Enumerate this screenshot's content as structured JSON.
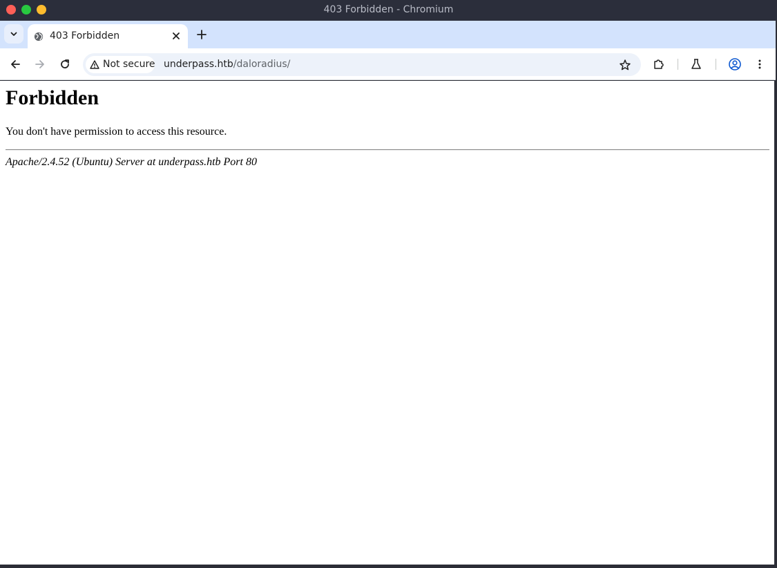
{
  "window": {
    "title": "403 Forbidden - Chromium"
  },
  "tabs": [
    {
      "title": "403 Forbidden",
      "icon": "globe-icon",
      "active": true
    }
  ],
  "toolbar": {
    "security_label": "Not secure",
    "url_host": "underpass.htb",
    "url_path": "/daloradius/"
  },
  "page": {
    "heading": "Forbidden",
    "message": "You don't have permission to access this resource.",
    "server_signature": "Apache/2.4.52 (Ubuntu) Server at underpass.htb Port 80"
  },
  "colors": {
    "titlebar": "#2b2e3b",
    "tabstrip": "#d3e3fd",
    "omnibox": "#edf2fa",
    "close": "#ff5f57",
    "maximize": "#28c840",
    "minimize": "#febc2e"
  }
}
